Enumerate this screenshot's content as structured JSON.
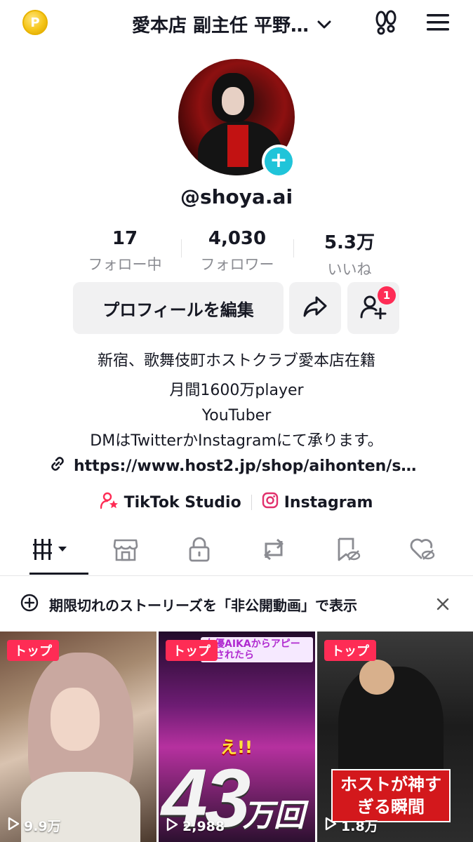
{
  "header": {
    "coin_symbol": "P",
    "title": "愛本店 副主任 平野…"
  },
  "profile": {
    "handle": "@shoya.ai"
  },
  "stats": [
    {
      "value": "17",
      "label": "フォロー中"
    },
    {
      "value": "4,030",
      "label": "フォロワー"
    },
    {
      "value": "5.3万",
      "label": "いいね"
    }
  ],
  "actions": {
    "edit_label": "プロフィールを編集",
    "friend_badge": "1"
  },
  "bio": {
    "line1": "新宿、歌舞伎町ホストクラブ愛本店在籍",
    "line2": "月間1600万player",
    "line3": "YouTuber",
    "line4": "DMはTwitterかInstagramにて承ります。",
    "link": "https://www.host2.jp/shop/aihonten/shoy..."
  },
  "socials": {
    "studio": "TikTok Studio",
    "instagram": "Instagram"
  },
  "tabs": [
    "videos-grid",
    "shop",
    "private",
    "reposts",
    "favorites",
    "liked"
  ],
  "banner": {
    "text": "期限切れのストーリーズを「非公開動画」で表示"
  },
  "videos": [
    {
      "tag": "トップ",
      "views": "9.9万"
    },
    {
      "tag": "トップ",
      "views": "2,988",
      "caption": "女優AIKAからアピールされたら",
      "big_text": "43",
      "sub_text": "万回",
      "exclaim": "え!!"
    },
    {
      "tag": "トップ",
      "views": "1.8万",
      "caption": "ホストが神すぎる瞬間"
    }
  ],
  "colors": {
    "accent_red": "#fe2c55",
    "plus_cyan": "#20c4d9",
    "button_bg": "#f1f1f2",
    "muted_text": "#8a8b91"
  }
}
